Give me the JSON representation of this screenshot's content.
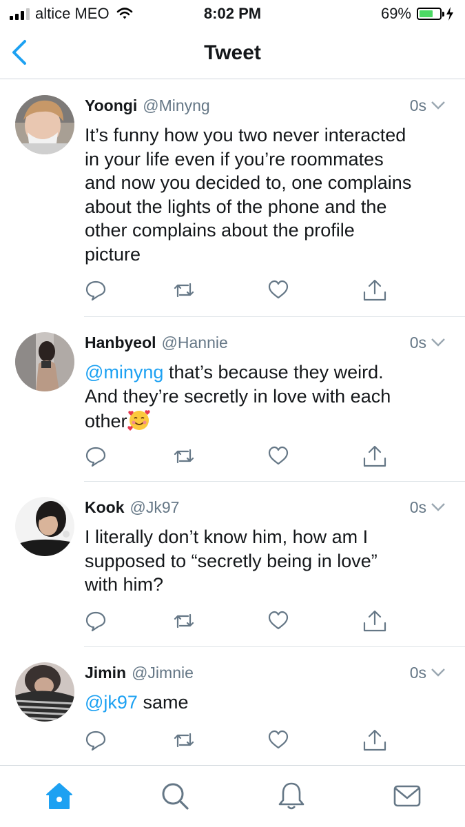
{
  "status": {
    "carrier": "altice MEO",
    "time": "8:02 PM",
    "battery_pct": "69%",
    "battery_level": 0.69
  },
  "nav": {
    "title": "Tweet"
  },
  "tweets": [
    {
      "name": "Yoongi",
      "handle": "@Minyng",
      "time": "0s",
      "lines": [
        "It’s funny how you two never interacted",
        "in your life even if you’re roommates",
        "and now you decided to, one complains",
        "about the lights of the phone and the",
        "other complains about the profile",
        "picture"
      ]
    },
    {
      "name": "Hanbyeol",
      "handle": "@Hannie",
      "time": "0s",
      "mention": "@minyng",
      "line1_rest": " that’s because they weird.",
      "line2": "And they’re secretly in love with each",
      "line3": "other"
    },
    {
      "name": "Kook",
      "handle": "@Jk97",
      "time": "0s",
      "lines": [
        "I literally don’t know him, how am I",
        "supposed to “secretly being in love”",
        "with him?"
      ]
    },
    {
      "name": "Jimin",
      "handle": "@Jimnie",
      "time": "0s",
      "mention": "@jk97",
      "rest": " same"
    }
  ],
  "icons": {
    "actions": [
      "reply-icon",
      "retweet-icon",
      "like-icon",
      "share-icon"
    ],
    "tabs": [
      "home-icon",
      "search-icon",
      "notifications-icon",
      "messages-icon"
    ]
  },
  "colors": {
    "accent": "#1da1f2",
    "text": "#14171a",
    "secondary": "#657786"
  }
}
